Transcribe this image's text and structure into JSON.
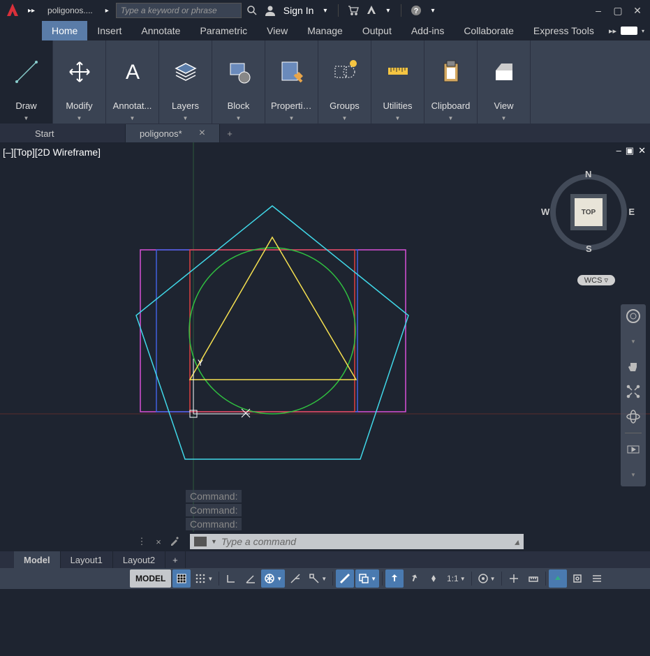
{
  "titlebar": {
    "filename": "poligonos....",
    "search_placeholder": "Type a keyword or phrase",
    "signin": "Sign In"
  },
  "menu": {
    "tabs": [
      "Home",
      "Insert",
      "Annotate",
      "Parametric",
      "View",
      "Manage",
      "Output",
      "Add-ins",
      "Collaborate",
      "Express Tools"
    ]
  },
  "ribbon": {
    "panels": [
      "Draw",
      "Modify",
      "Annotat...",
      "Layers",
      "Block",
      "Properties",
      "Groups",
      "Utilities",
      "Clipboard",
      "View"
    ]
  },
  "docs": {
    "tabs": [
      "Start",
      "poligonos*"
    ]
  },
  "viewport": {
    "view_label": "[–][Top][2D Wireframe]",
    "cube_face": "TOP",
    "dirs": {
      "n": "N",
      "s": "S",
      "e": "E",
      "w": "W"
    },
    "wcs": "WCS"
  },
  "cmd": {
    "history": [
      "Command:",
      "Command:",
      "Command:"
    ],
    "placeholder": "Type a command"
  },
  "layouts": {
    "tabs": [
      "Model",
      "Layout1",
      "Layout2"
    ]
  },
  "status": {
    "model": "MODEL",
    "scale": "1:1"
  }
}
